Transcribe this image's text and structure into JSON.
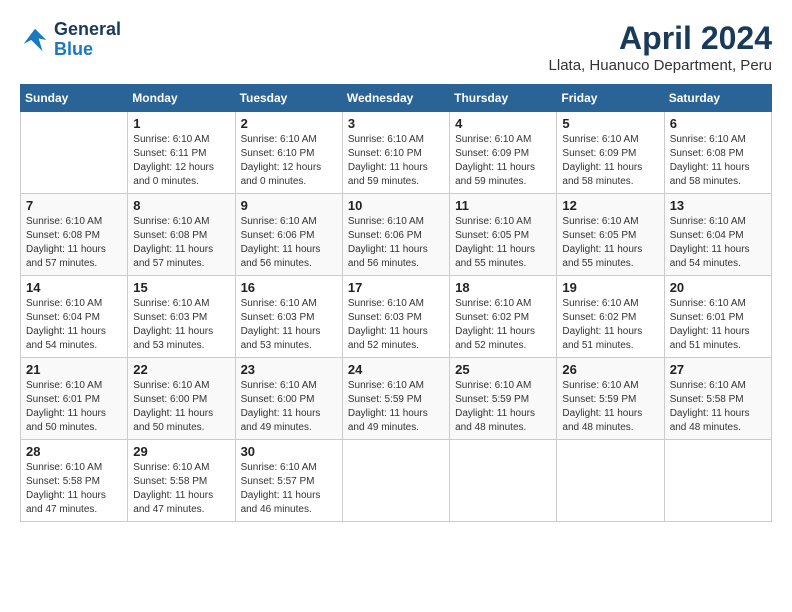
{
  "header": {
    "logo_line1": "General",
    "logo_line2": "Blue",
    "title": "April 2024",
    "subtitle": "Llata, Huanuco Department, Peru"
  },
  "calendar": {
    "days_of_week": [
      "Sunday",
      "Monday",
      "Tuesday",
      "Wednesday",
      "Thursday",
      "Friday",
      "Saturday"
    ],
    "weeks": [
      [
        {
          "num": "",
          "sunrise": "",
          "sunset": "",
          "daylight": ""
        },
        {
          "num": "1",
          "sunrise": "Sunrise: 6:10 AM",
          "sunset": "Sunset: 6:11 PM",
          "daylight": "Daylight: 12 hours and 0 minutes."
        },
        {
          "num": "2",
          "sunrise": "Sunrise: 6:10 AM",
          "sunset": "Sunset: 6:10 PM",
          "daylight": "Daylight: 12 hours and 0 minutes."
        },
        {
          "num": "3",
          "sunrise": "Sunrise: 6:10 AM",
          "sunset": "Sunset: 6:10 PM",
          "daylight": "Daylight: 11 hours and 59 minutes."
        },
        {
          "num": "4",
          "sunrise": "Sunrise: 6:10 AM",
          "sunset": "Sunset: 6:09 PM",
          "daylight": "Daylight: 11 hours and 59 minutes."
        },
        {
          "num": "5",
          "sunrise": "Sunrise: 6:10 AM",
          "sunset": "Sunset: 6:09 PM",
          "daylight": "Daylight: 11 hours and 58 minutes."
        },
        {
          "num": "6",
          "sunrise": "Sunrise: 6:10 AM",
          "sunset": "Sunset: 6:08 PM",
          "daylight": "Daylight: 11 hours and 58 minutes."
        }
      ],
      [
        {
          "num": "7",
          "sunrise": "Sunrise: 6:10 AM",
          "sunset": "Sunset: 6:08 PM",
          "daylight": "Daylight: 11 hours and 57 minutes."
        },
        {
          "num": "8",
          "sunrise": "Sunrise: 6:10 AM",
          "sunset": "Sunset: 6:08 PM",
          "daylight": "Daylight: 11 hours and 57 minutes."
        },
        {
          "num": "9",
          "sunrise": "Sunrise: 6:10 AM",
          "sunset": "Sunset: 6:06 PM",
          "daylight": "Daylight: 11 hours and 56 minutes."
        },
        {
          "num": "10",
          "sunrise": "Sunrise: 6:10 AM",
          "sunset": "Sunset: 6:06 PM",
          "daylight": "Daylight: 11 hours and 56 minutes."
        },
        {
          "num": "11",
          "sunrise": "Sunrise: 6:10 AM",
          "sunset": "Sunset: 6:05 PM",
          "daylight": "Daylight: 11 hours and 55 minutes."
        },
        {
          "num": "12",
          "sunrise": "Sunrise: 6:10 AM",
          "sunset": "Sunset: 6:05 PM",
          "daylight": "Daylight: 11 hours and 55 minutes."
        },
        {
          "num": "13",
          "sunrise": "Sunrise: 6:10 AM",
          "sunset": "Sunset: 6:04 PM",
          "daylight": "Daylight: 11 hours and 54 minutes."
        }
      ],
      [
        {
          "num": "14",
          "sunrise": "Sunrise: 6:10 AM",
          "sunset": "Sunset: 6:04 PM",
          "daylight": "Daylight: 11 hours and 54 minutes."
        },
        {
          "num": "15",
          "sunrise": "Sunrise: 6:10 AM",
          "sunset": "Sunset: 6:03 PM",
          "daylight": "Daylight: 11 hours and 53 minutes."
        },
        {
          "num": "16",
          "sunrise": "Sunrise: 6:10 AM",
          "sunset": "Sunset: 6:03 PM",
          "daylight": "Daylight: 11 hours and 53 minutes."
        },
        {
          "num": "17",
          "sunrise": "Sunrise: 6:10 AM",
          "sunset": "Sunset: 6:03 PM",
          "daylight": "Daylight: 11 hours and 52 minutes."
        },
        {
          "num": "18",
          "sunrise": "Sunrise: 6:10 AM",
          "sunset": "Sunset: 6:02 PM",
          "daylight": "Daylight: 11 hours and 52 minutes."
        },
        {
          "num": "19",
          "sunrise": "Sunrise: 6:10 AM",
          "sunset": "Sunset: 6:02 PM",
          "daylight": "Daylight: 11 hours and 51 minutes."
        },
        {
          "num": "20",
          "sunrise": "Sunrise: 6:10 AM",
          "sunset": "Sunset: 6:01 PM",
          "daylight": "Daylight: 11 hours and 51 minutes."
        }
      ],
      [
        {
          "num": "21",
          "sunrise": "Sunrise: 6:10 AM",
          "sunset": "Sunset: 6:01 PM",
          "daylight": "Daylight: 11 hours and 50 minutes."
        },
        {
          "num": "22",
          "sunrise": "Sunrise: 6:10 AM",
          "sunset": "Sunset: 6:00 PM",
          "daylight": "Daylight: 11 hours and 50 minutes."
        },
        {
          "num": "23",
          "sunrise": "Sunrise: 6:10 AM",
          "sunset": "Sunset: 6:00 PM",
          "daylight": "Daylight: 11 hours and 49 minutes."
        },
        {
          "num": "24",
          "sunrise": "Sunrise: 6:10 AM",
          "sunset": "Sunset: 5:59 PM",
          "daylight": "Daylight: 11 hours and 49 minutes."
        },
        {
          "num": "25",
          "sunrise": "Sunrise: 6:10 AM",
          "sunset": "Sunset: 5:59 PM",
          "daylight": "Daylight: 11 hours and 48 minutes."
        },
        {
          "num": "26",
          "sunrise": "Sunrise: 6:10 AM",
          "sunset": "Sunset: 5:59 PM",
          "daylight": "Daylight: 11 hours and 48 minutes."
        },
        {
          "num": "27",
          "sunrise": "Sunrise: 6:10 AM",
          "sunset": "Sunset: 5:58 PM",
          "daylight": "Daylight: 11 hours and 48 minutes."
        }
      ],
      [
        {
          "num": "28",
          "sunrise": "Sunrise: 6:10 AM",
          "sunset": "Sunset: 5:58 PM",
          "daylight": "Daylight: 11 hours and 47 minutes."
        },
        {
          "num": "29",
          "sunrise": "Sunrise: 6:10 AM",
          "sunset": "Sunset: 5:58 PM",
          "daylight": "Daylight: 11 hours and 47 minutes."
        },
        {
          "num": "30",
          "sunrise": "Sunrise: 6:10 AM",
          "sunset": "Sunset: 5:57 PM",
          "daylight": "Daylight: 11 hours and 46 minutes."
        },
        {
          "num": "",
          "sunrise": "",
          "sunset": "",
          "daylight": ""
        },
        {
          "num": "",
          "sunrise": "",
          "sunset": "",
          "daylight": ""
        },
        {
          "num": "",
          "sunrise": "",
          "sunset": "",
          "daylight": ""
        },
        {
          "num": "",
          "sunrise": "",
          "sunset": "",
          "daylight": ""
        }
      ]
    ]
  }
}
